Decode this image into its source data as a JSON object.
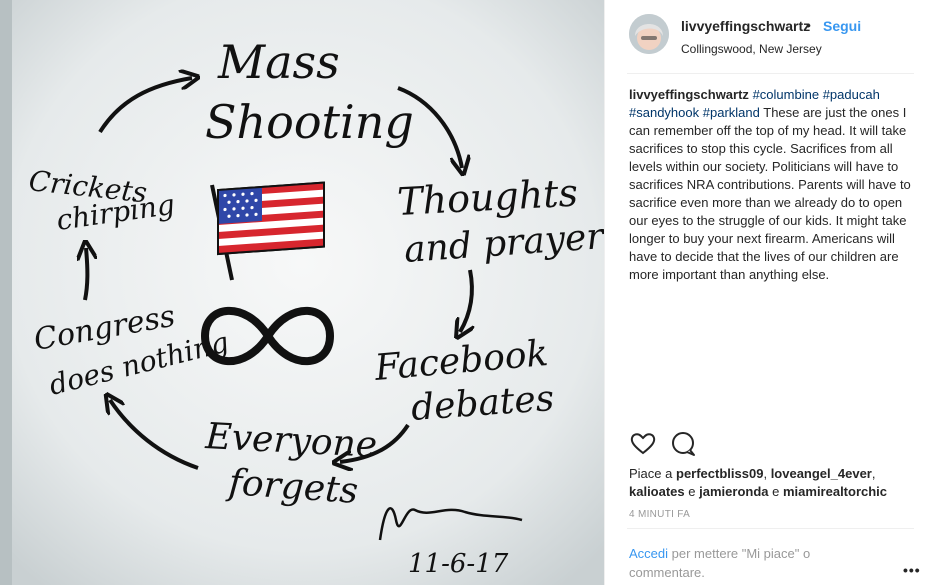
{
  "post": {
    "image_text": {
      "node1_line1": "Mass",
      "node1_line2": "Shooting",
      "node2_line1": "Thoughts",
      "node2_line2": "and prayers",
      "node3_line1": "Facebook",
      "node3_line2": "debates",
      "node4_line1": "Everyone",
      "node4_line2": "forgets",
      "node5_line1": "Congress",
      "node5_line2": "does nothing",
      "node6_line1": "Crickets",
      "node6_line2": "chirping",
      "date": "11-6-17"
    },
    "header": {
      "username": "livvyeffingschwartz",
      "separator": "•",
      "follow_label": "Segui",
      "location": "Collingswood, New Jersey"
    },
    "caption": {
      "username": "livvyeffingschwartz",
      "hashtags": [
        "#columbine",
        "#paducah",
        "#sandyhook",
        "#parkland"
      ],
      "text": "These are just the ones I can remember off the top of my head. It will take sacrifices to stop this cycle. Sacrifices from all levels within our society. Politicians will have to sacrifices NRA contributions. Parents will have to sacrifice even more than we already do to open our eyes to the struggle of our kids. It might take longer to buy your next firearm. Americans will have to decide that the lives of our children are more important than anything else."
    },
    "likes": {
      "prefix": "Piace a",
      "users": [
        "perfectbliss09",
        "loveangel_4ever",
        "kalioates",
        "jamieronda",
        "miamirealtorchic"
      ],
      "sep_comma": ",",
      "sep_and": "e"
    },
    "timestamp": "4 MINUTI FA",
    "login_prompt": {
      "link": "Accedi",
      "text": "per mettere \"Mi piace\" o commentare."
    },
    "more_label": "•••",
    "icons": {
      "like": "heart-icon",
      "comment": "comment-icon",
      "more": "more-options-icon"
    },
    "colors": {
      "accent": "#3897f0",
      "hashtag": "#003569",
      "text": "#262626",
      "muted": "#999999"
    }
  }
}
